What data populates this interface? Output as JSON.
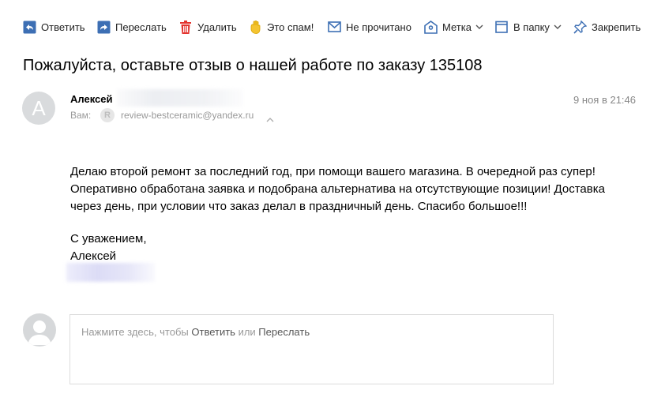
{
  "toolbar": {
    "reply": "Ответить",
    "forward": "Переслать",
    "delete": "Удалить",
    "spam": "Это спам!",
    "unread": "Не прочитано",
    "label": "Метка",
    "folder": "В папку",
    "pin": "Закрепить"
  },
  "colors": {
    "accent": "#3d6fb4",
    "delete": "#e3342f",
    "spam": "#f0c020"
  },
  "message": {
    "subject": "Пожалуйста, оставьте отзыв о нашей работе по заказу 135108",
    "sender_name": "Алексей",
    "avatar_letter": "A",
    "date": "9 ноя в 21:46",
    "to_label": "Вам:",
    "to_icon_letter": "R",
    "to_email": "review-bestceramic@yandex.ru",
    "body_lines": [
      "Делаю второй ремонт за последний год, при помощи вашего магазина. В очередной раз супер!",
      "Оперативно обработана заявка и подобрана альтернатива на отсутствующие позиции! Доставка",
      "через день, при условии что заказ делал в праздничный день. Спасибо большое!!!"
    ],
    "signature": [
      "С уважением,",
      "Алексей"
    ]
  },
  "reply": {
    "hint_prefix": "Нажмите здесь, чтобы ",
    "reply_link": "Ответить",
    "or": " или ",
    "forward_link": "Переслать"
  }
}
